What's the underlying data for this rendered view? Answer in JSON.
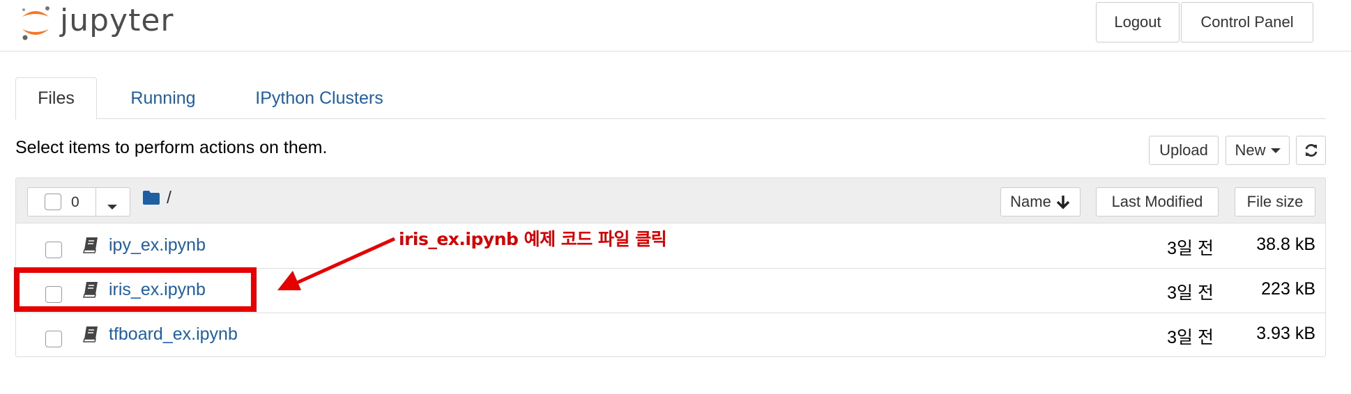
{
  "header": {
    "logo_text": "jupyter",
    "logout_label": "Logout",
    "control_panel_label": "Control Panel"
  },
  "tabs": [
    {
      "label": "Files",
      "active": true
    },
    {
      "label": "Running",
      "active": false
    },
    {
      "label": "IPython Clusters",
      "active": false
    }
  ],
  "toolbar": {
    "instruction": "Select items to perform actions on them.",
    "upload_label": "Upload",
    "new_label": "New",
    "refresh_icon": "refresh-icon"
  },
  "list_header": {
    "selected_count": "0",
    "path": "/",
    "sort_name_label": "Name",
    "sort_modified_label": "Last Modified",
    "sort_size_label": "File size"
  },
  "files": [
    {
      "name": "ipy_ex.ipynb",
      "modified": "3일 전",
      "size": "38.8 kB"
    },
    {
      "name": "iris_ex.ipynb",
      "modified": "3일 전",
      "size": "223 kB"
    },
    {
      "name": "tfboard_ex.ipynb",
      "modified": "3일 전",
      "size": "3.93 kB"
    }
  ],
  "annotation": {
    "text": "iris_ex.ipynb 예제 코드 파일 클릭",
    "color": "#e60000"
  },
  "colors": {
    "link": "#1e5fa3",
    "logo_orange": "#f37726",
    "border": "#dddddd"
  }
}
